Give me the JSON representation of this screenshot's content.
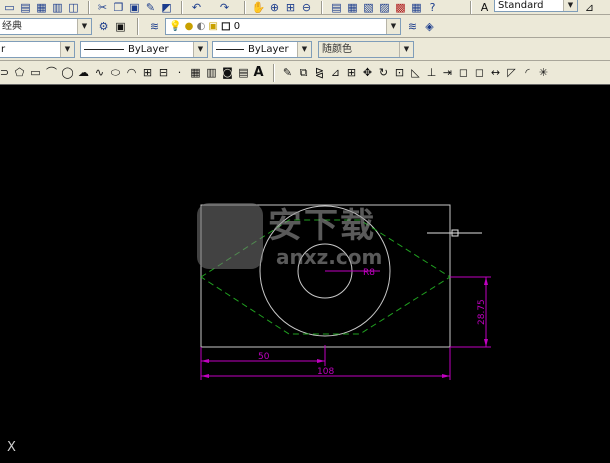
{
  "toolbar_top": {
    "text_style_value": "Standard"
  },
  "toolbar_workspace": {
    "workspace_value": "经典",
    "layer_value": "0"
  },
  "toolbar_properties": {
    "color_value": "r",
    "linetype_value": "ByLayer",
    "lineweight_value": "ByLayer",
    "plotstyle_value": "随颜色"
  },
  "toolbar_draw": {
    "text_tool_label": "A"
  },
  "drawing": {
    "dim_radius": "R8",
    "dim_width": "108",
    "dim_half": "50",
    "dim_height": "28.75"
  },
  "watermark": {
    "title": "安下载",
    "subtitle": "anxz.com"
  },
  "ucs": {
    "x_label": "X"
  },
  "colors": {
    "toolbar_bg": "#ece9d8",
    "canvas_bg": "#000000",
    "geometry": "#c8c8c8",
    "dimension": "#c000c0",
    "hidden_line": "#20a020"
  }
}
